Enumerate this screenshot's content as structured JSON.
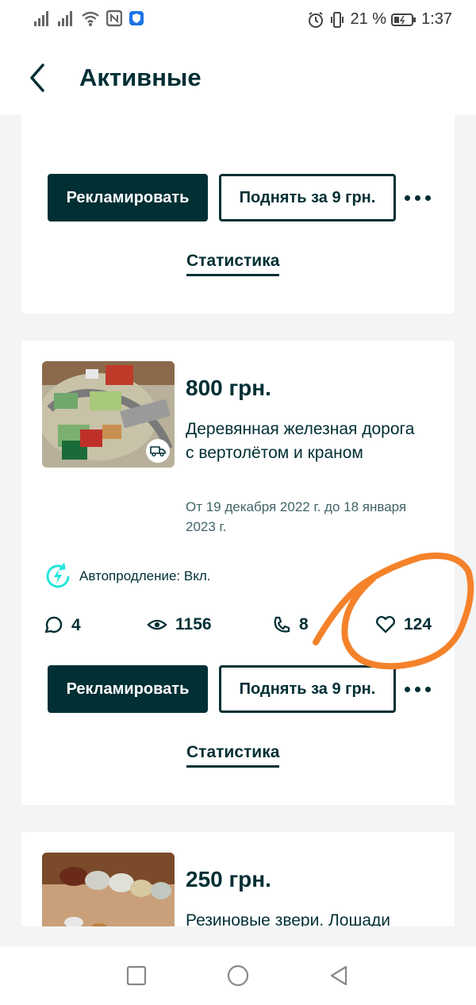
{
  "status_bar": {
    "battery_percent": "21 %",
    "time": "1:37"
  },
  "header": {
    "title": "Активные"
  },
  "ads": [
    {
      "primary_button": "Рекламировать",
      "raise_button": "Поднять за 9 грн.",
      "statistics_link": "Статистика"
    },
    {
      "price": "800 грн.",
      "title": "Деревянная железная дорога с вертолётом и краном",
      "dates": "От 19 декабря 2022 г. до 18 января 2023 г.",
      "auto_renew": "Автопродление: Вкл.",
      "stats": {
        "messages": "4",
        "views": "1156",
        "calls": "8",
        "favorites": "124"
      },
      "primary_button": "Рекламировать",
      "raise_button": "Поднять за 9 грн.",
      "statistics_link": "Статистика"
    },
    {
      "price": "250 грн.",
      "title": "Резиновые звери. Лошади"
    }
  ],
  "colors": {
    "brand_dark": "#002f34",
    "accent_teal": "#23e5db",
    "annotation_orange": "#f5822a",
    "background": "#f2f4f5"
  }
}
